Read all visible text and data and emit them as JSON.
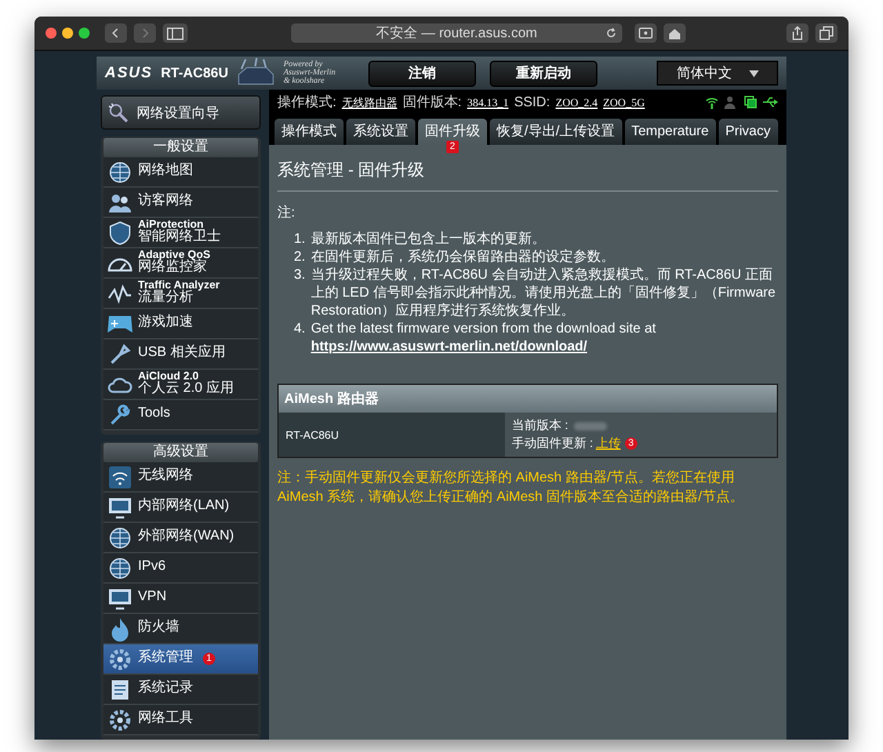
{
  "browser": {
    "address": "不安全 — router.asus.com"
  },
  "header": {
    "logo": "ASUS",
    "model": "RT-AC86U",
    "powered": [
      "Powered by",
      "Asuswrt-Merlin",
      "& koolshare"
    ],
    "buttons": [
      "注销",
      "重新启动"
    ],
    "language": "简体中文"
  },
  "status": {
    "mode_label": "操作模式:",
    "mode": "无线路由器",
    "firmware_label": "固件版本:",
    "firmware": "384.13_1",
    "ssid_label": "SSID:",
    "ssids": [
      "ZOO_2.4",
      "ZOO_5G"
    ]
  },
  "quick_setup": "网络设置向导",
  "sidebar": [
    {
      "heading": "一般设置",
      "items": [
        {
          "title": "网络地图",
          "selected": false
        },
        {
          "title": "访客网络",
          "selected": false
        },
        {
          "title": "AiProtection",
          "subtitle": "智能网络卫士",
          "selected": false
        },
        {
          "title": "Adaptive QoS",
          "subtitle": "网络监控家",
          "selected": false
        },
        {
          "title": "Traffic Analyzer",
          "subtitle": "流量分析",
          "selected": false
        },
        {
          "title": "游戏加速",
          "selected": false
        },
        {
          "title": "USB 相关应用",
          "selected": false
        },
        {
          "title": "AiCloud 2.0",
          "subtitle": "个人云 2.0 应用",
          "selected": false
        },
        {
          "title": "Tools",
          "selected": false
        }
      ]
    },
    {
      "heading": "高级设置",
      "items": [
        {
          "title": "无线网络",
          "selected": false
        },
        {
          "title": "内部网络(LAN)",
          "selected": false
        },
        {
          "title": "外部网络(WAN)",
          "selected": false
        },
        {
          "title": "IPv6",
          "selected": false
        },
        {
          "title": "VPN",
          "selected": false
        },
        {
          "title": "防火墙",
          "selected": false
        },
        {
          "title": "系统管理",
          "selected": true,
          "annotation": "1"
        },
        {
          "title": "系统记录",
          "selected": false
        },
        {
          "title": "网络工具",
          "selected": false
        }
      ]
    }
  ],
  "tabs": [
    {
      "label": "操作模式",
      "selected": false
    },
    {
      "label": "系统设置",
      "selected": false
    },
    {
      "label": "固件升级",
      "selected": true,
      "annotation": "2"
    },
    {
      "label": "恢复/导出/上传设置",
      "selected": false
    },
    {
      "label": "Temperature",
      "selected": false
    },
    {
      "label": "Privacy",
      "selected": false
    }
  ],
  "page": {
    "title": "系统管理 - 固件升级",
    "note_label": "注:",
    "notes": [
      {
        "number": "1.",
        "text": "最新版本固件已包含上一版本的更新。"
      },
      {
        "number": "2.",
        "text": "在固件更新后，系统仍会保留路由器的设定参数。"
      },
      {
        "number": "3.",
        "text": "当升级过程失败，RT-AC86U 会自动进入紧急救援模式。而 RT-AC86U 正面上的 LED 信号即会指示此种情况。请使用光盘上的「固件修复」（Firmware Restoration）应用程序进行系统恢复作业。"
      },
      {
        "number": "4.",
        "text": "Get the latest firmware version from the download site at",
        "link": "https://www.asuswrt-merlin.net/download/"
      }
    ]
  },
  "aimesh": {
    "heading": "AiMesh 路由器",
    "device": "RT-AC86U",
    "current_label": "当前版本 :",
    "update_label": "手动固件更新 :",
    "update_link": "上传",
    "annotation": "3",
    "warning": "注：手动固件更新仅会更新您所选择的 AiMesh 路由器/节点。若您正在使用 AiMesh 系统，请确认您上传正确的 AiMesh 固件版本至合适的路由器/节点。"
  }
}
